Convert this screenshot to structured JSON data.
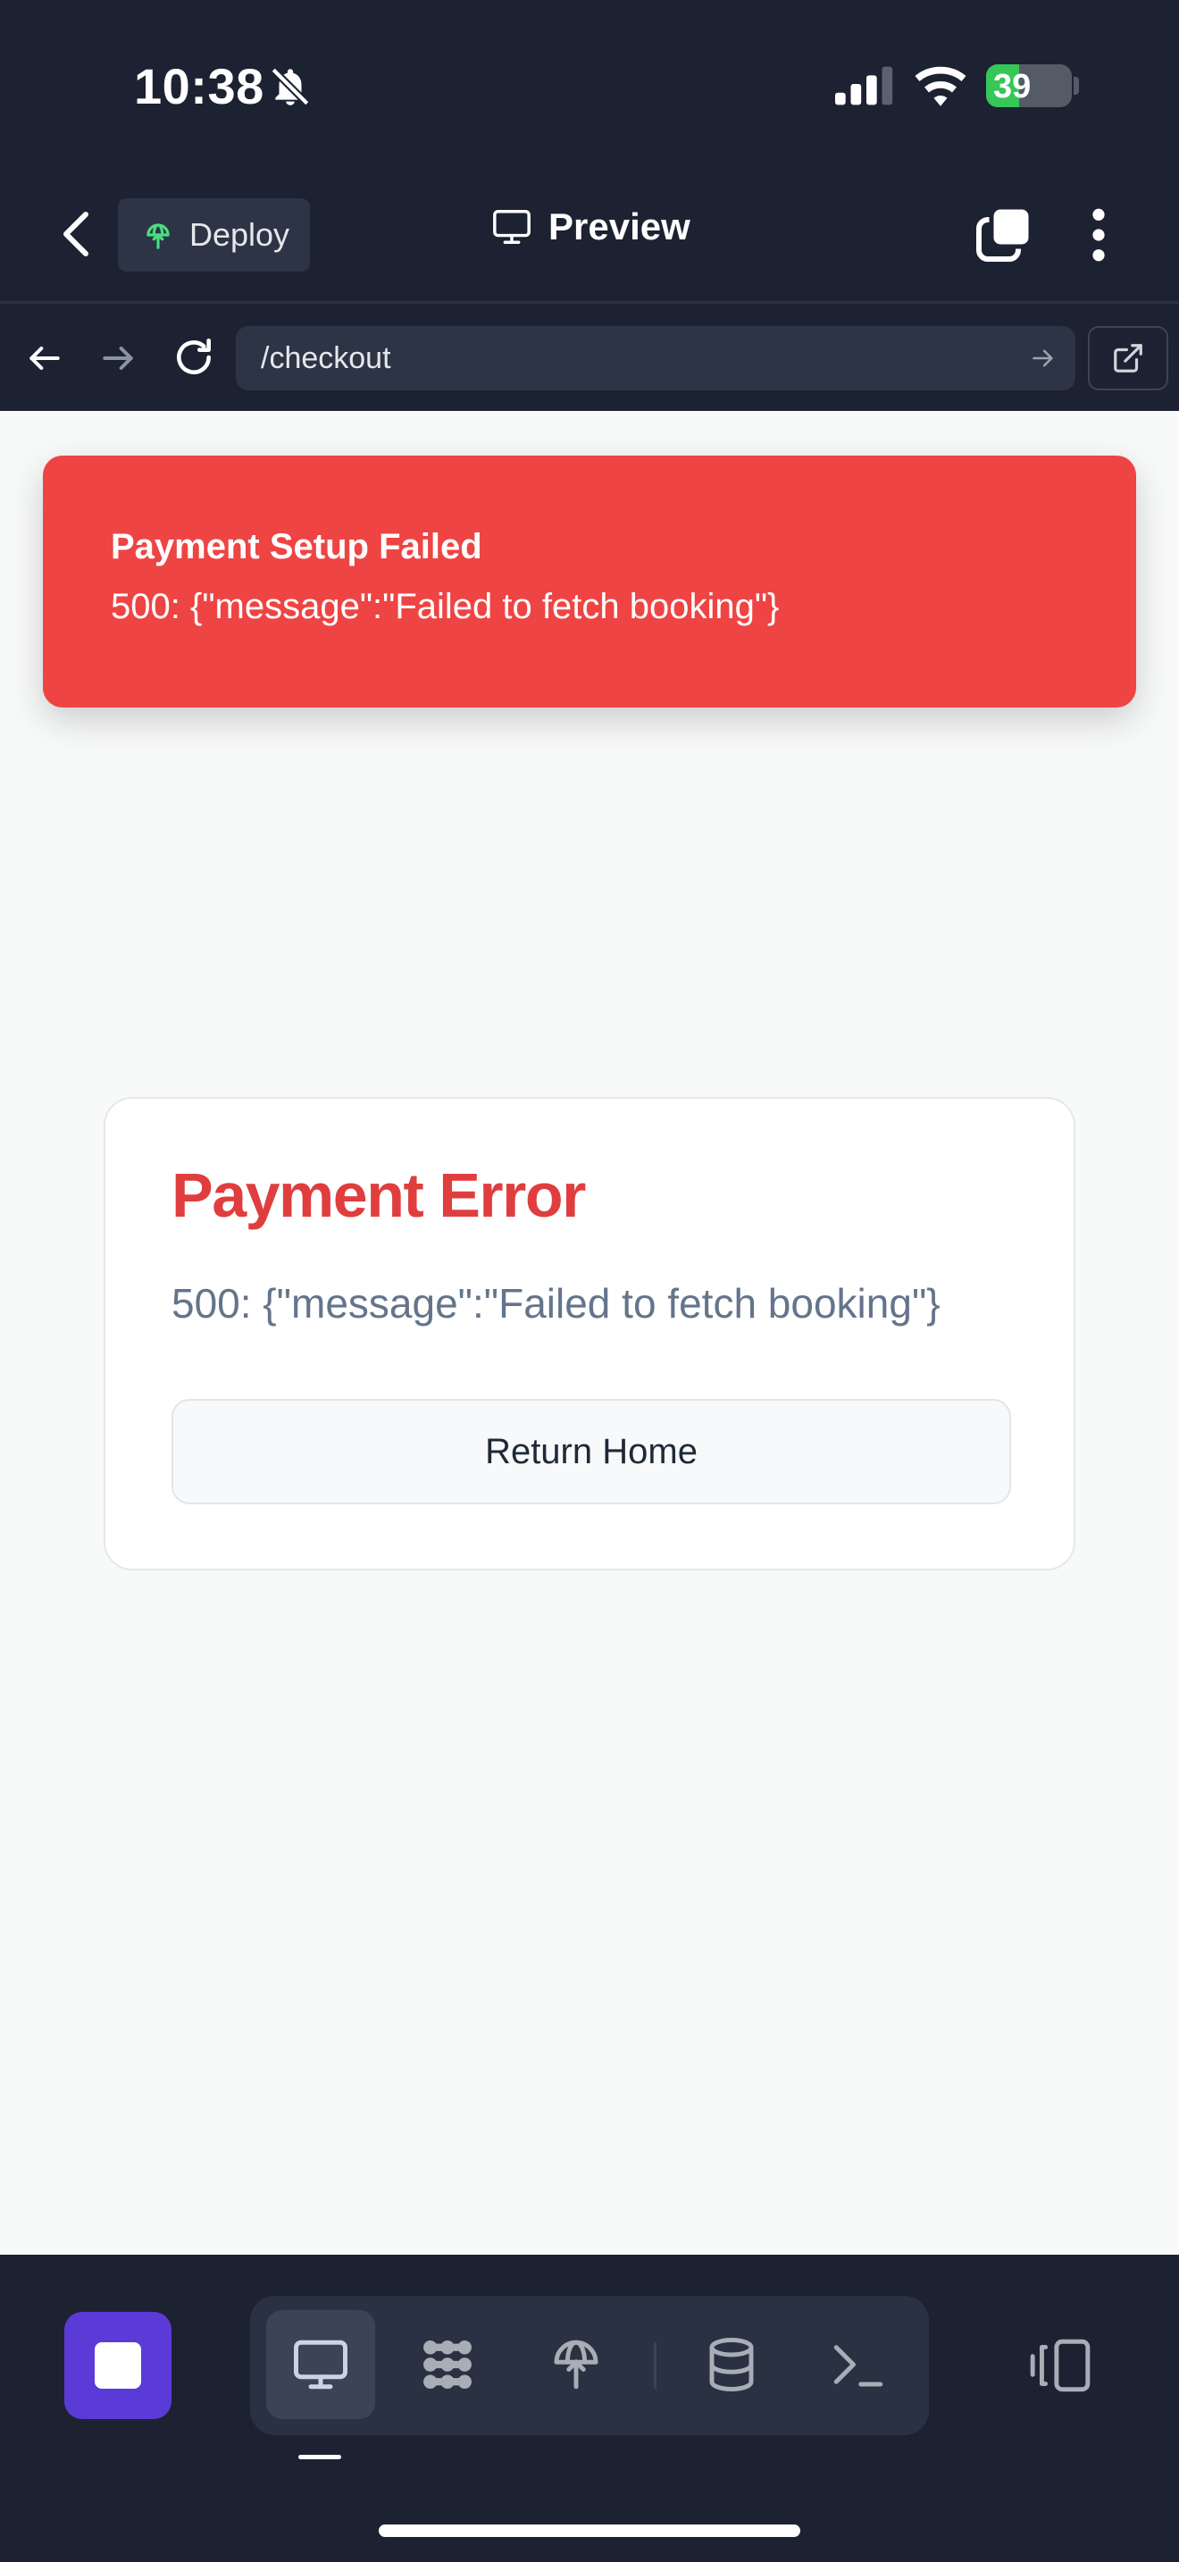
{
  "status_bar": {
    "time": "10:38",
    "battery": "39",
    "battery_level": 0.39,
    "icons": [
      "bell-slash-icon",
      "cellular-signal-icon",
      "wifi-icon",
      "battery-charging-icon"
    ]
  },
  "header": {
    "deploy_label": "Deploy",
    "title": "Preview",
    "icons": [
      "back-icon",
      "deploy-icon",
      "monitor-icon",
      "tabs-icon",
      "more-vertical-icon"
    ]
  },
  "browser": {
    "url": "/checkout",
    "icons": [
      "arrow-left-icon",
      "arrow-right-icon",
      "reload-icon",
      "go-arrow-icon",
      "external-link-icon"
    ]
  },
  "toast": {
    "title": "Payment Setup Failed",
    "message": "500: {\"message\":\"Failed to fetch booking\"}"
  },
  "error_card": {
    "title": "Payment Error",
    "message": "500: {\"message\":\"Failed to fetch booking\"}",
    "button_label": "Return Home"
  },
  "bottom_bar": {
    "tools": [
      "preview-icon",
      "workflow-icon",
      "deploy-icon",
      "database-icon",
      "terminal-icon"
    ],
    "active_tool": "preview-icon",
    "extra_icons": [
      "stop-icon",
      "panel-icon"
    ]
  },
  "colors": {
    "chrome_bg": "#1c2232",
    "toast_red": "#ef4444",
    "error_title_red": "#e03e3e",
    "stop_purple": "#5b3bd8",
    "battery_green": "#36c759",
    "page_bg": "#f8f9f9"
  }
}
